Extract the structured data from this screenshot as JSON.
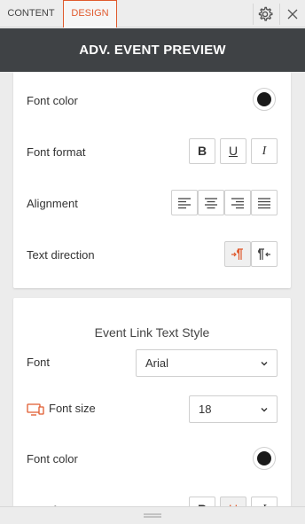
{
  "tabs": {
    "content": "CONTENT",
    "design": "DESIGN"
  },
  "header": {
    "title": "ADV. EVENT PREVIEW"
  },
  "text_style_card": {
    "font_color_label": "Font color",
    "font_color_value": "#1a1a1a",
    "font_format_label": "Font format",
    "format_buttons": [
      "B",
      "U",
      "I"
    ],
    "alignment_label": "Alignment",
    "alignment_buttons": [
      "align-left-icon",
      "align-center-icon",
      "align-right-icon",
      "align-justify-icon"
    ],
    "text_direction_label": "Text direction",
    "direction_buttons": [
      "ltr-icon",
      "rtl-icon"
    ],
    "active_direction": "ltr"
  },
  "link_style_card": {
    "title": "Event Link Text Style",
    "font_label": "Font",
    "font_value": "Arial",
    "font_size_label": "Font size",
    "font_size_value": "18",
    "font_color_label": "Font color",
    "font_color_value": "#1a1a1a"
  },
  "colors": {
    "accent": "#e05a2e",
    "header_bg": "#3f4245"
  }
}
